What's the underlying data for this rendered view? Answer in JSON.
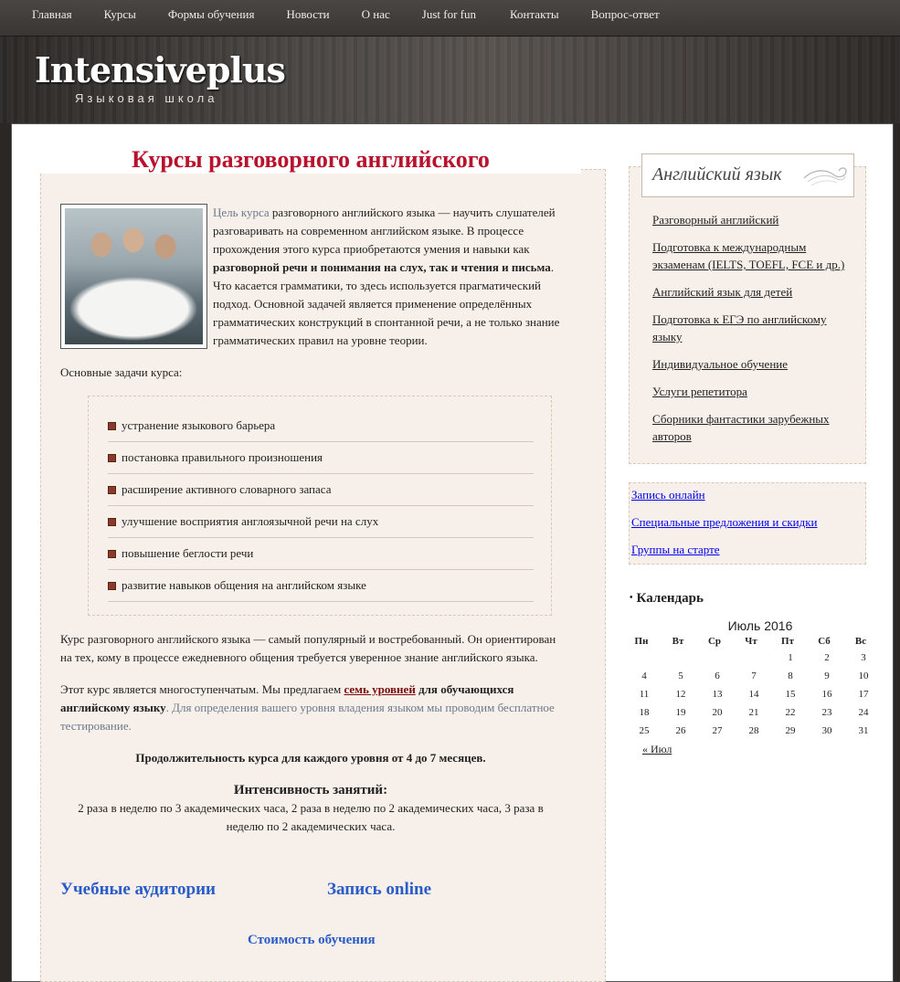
{
  "nav": {
    "items": [
      "Главная",
      "Курсы",
      "Формы обучения",
      "Новости",
      "О нас",
      "Just for fun",
      "Контакты",
      "Вопрос-ответ"
    ]
  },
  "brand": {
    "name": "Intensiveplus",
    "tagline": "Языковая школа"
  },
  "main": {
    "title": "Курсы разговорного английского",
    "intro_lead": "Цель курса",
    "intro_text_1": " разговорного английского языка  — научить слушателей разговаривать на современном английском языке. В процессе прохождения этого курса приобретаются умения и навыки как ",
    "intro_bold": "разговорной речи и понимания на слух, так и чтения и письма",
    "intro_text_2": ". Что касается грамматики, то здесь  используется прагматический подход. Основной задачей является применение определённых грамматических конструкций в спонтанной речи, а не только знание грамматических правил на уровне теории.",
    "tasks_label": "Основные задачи курса:",
    "tasks": [
      "устранение языкового барьера",
      "постановка правильного произношения",
      "расширение активного словарного запаса",
      "улучшение восприятия англоязычной речи на слух",
      "повышение беглости речи",
      "развитие навыков общения на английском языке"
    ],
    "para1": "Курс разговорного английского языка — самый популярный и востребованный. Он ориентирован на тех, кому в процессе ежедневного общения требуется уверенное знание английского языка.",
    "para2_a": "Этот курс является многоступенчатым. Мы предлагаем ",
    "para2_link": "семь уровней",
    "para2_b": "  для обучающихся английскому языку",
    "para2_c": ". Для определения вашего уровня владения языком мы проводим бесплатное тестирование.",
    "duration": "Продолжительность курса для каждого уровня от 4 до 7 месяцев.",
    "intensity_title": "Интенсивность занятий:",
    "intensity_text": "2 раза в неделю по 3 академических часа, 2 раза в неделю по 2  академических часа,  3 раза в неделю по 2 академических часа.",
    "link_classrooms": "Учебные аудитории",
    "link_signup": "Запись online",
    "link_price": "Стоимость обучения"
  },
  "sidebar": {
    "title": "Английский язык",
    "items": [
      "Разговорный английский",
      "Подготовка к международным экзаменам (IELTS, TOEFL, FCE и др.)",
      "Английский язык для детей",
      "Подготовка к ЕГЭ по английскому языку",
      "Индивидуальное обучение",
      "Услуги репетитора",
      "Сборники фантастики зарубежных авторов"
    ],
    "links": [
      "Запись онлайн",
      "Специальные предложения и скидки",
      "Группы на старте"
    ]
  },
  "calendar": {
    "title": "Календарь",
    "caption": "Июль 2016",
    "weekdays": [
      "Пн",
      "Вт",
      "Ср",
      "Чт",
      "Пт",
      "Сб",
      "Вс"
    ],
    "weeks": [
      [
        "",
        "",
        "",
        "",
        "1",
        "2",
        "3"
      ],
      [
        "4",
        "5",
        "6",
        "7",
        "8",
        "9",
        "10"
      ],
      [
        "11",
        "12",
        "13",
        "14",
        "15",
        "16",
        "17"
      ],
      [
        "18",
        "19",
        "20",
        "21",
        "22",
        "23",
        "24"
      ],
      [
        "25",
        "26",
        "27",
        "28",
        "29",
        "30",
        "31"
      ]
    ],
    "prev": "« Июл"
  },
  "colors": {
    "title": "#b8122c",
    "link": "#2a5cc9",
    "box_bg": "#f7efe9"
  }
}
